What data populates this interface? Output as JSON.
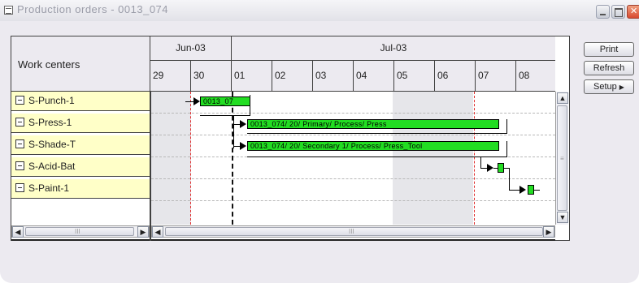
{
  "window": {
    "title": "Production orders - 0013_074"
  },
  "header": {
    "work_centers_label": "Work centers",
    "months": [
      {
        "label": "Jun-03"
      },
      {
        "label": "Jul-03"
      }
    ],
    "days": [
      "29",
      "30",
      "01",
      "02",
      "03",
      "04",
      "05",
      "06",
      "07",
      "08"
    ]
  },
  "work_centers": [
    {
      "label": "S-Punch-1"
    },
    {
      "label": "S-Press-1"
    },
    {
      "label": "S-Shade-T"
    },
    {
      "label": "S-Acid-Bat"
    },
    {
      "label": "S-Paint-1"
    }
  ],
  "bars": [
    {
      "label": "0013_07"
    },
    {
      "label": "0013_074/ 20/ Primary/ Process/ Press"
    },
    {
      "label": "0013_074/ 20/ Secondary 1/ Process/ Press_Tool"
    },
    {
      "label": ""
    },
    {
      "label": ""
    }
  ],
  "buttons": {
    "print": "Print",
    "refresh": "Refresh",
    "setup": "Setup"
  },
  "scroll": {
    "h_grip": "III",
    "v_grip": "≡"
  },
  "colors": {
    "work_center_bg": "#ffffc8",
    "bar_fill": "#22dd22",
    "weekend_shade": "#e6e6ea",
    "today_line": "#e03030"
  }
}
